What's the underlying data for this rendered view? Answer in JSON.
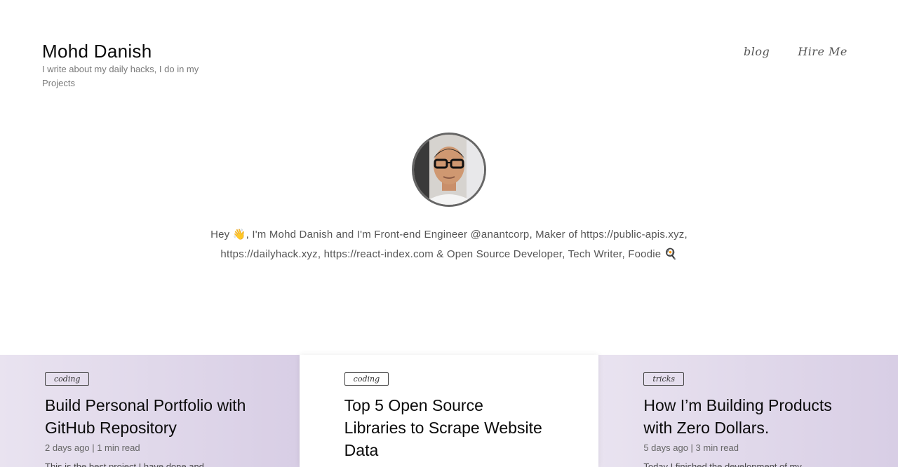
{
  "header": {
    "title": "Mohd Danish",
    "tagline": "I write about my daily hacks, I do in my Projects"
  },
  "nav": {
    "items": [
      {
        "label": "blog"
      },
      {
        "label": "Hire Me"
      }
    ]
  },
  "intro": {
    "text": "Hey 👋, I'm Mohd Danish and I'm Front-end Engineer @anantcorp, Maker of https://public-apis.xyz, https://dailyhack.xyz, https://react-index.com & Open Source Developer, Tech Writer, Foodie 🍳"
  },
  "posts": [
    {
      "tag": "coding",
      "title": "Build Personal Portfolio with GitHub Repository",
      "meta": "2 days ago | 1 min read",
      "excerpt": "This is the best project I have done and"
    },
    {
      "tag": "coding",
      "title": "Top 5 Open Source Libraries to Scrape Website Data",
      "meta": "",
      "excerpt": ""
    },
    {
      "tag": "tricks",
      "title": "How I’m Building Products with Zero Dollars.",
      "meta": "5 days ago | 3 min read",
      "excerpt": "Today I finished the development of my"
    }
  ],
  "colors": {
    "card_tint_start": "#e9e3f0",
    "card_tint_end": "#d8cee5"
  }
}
